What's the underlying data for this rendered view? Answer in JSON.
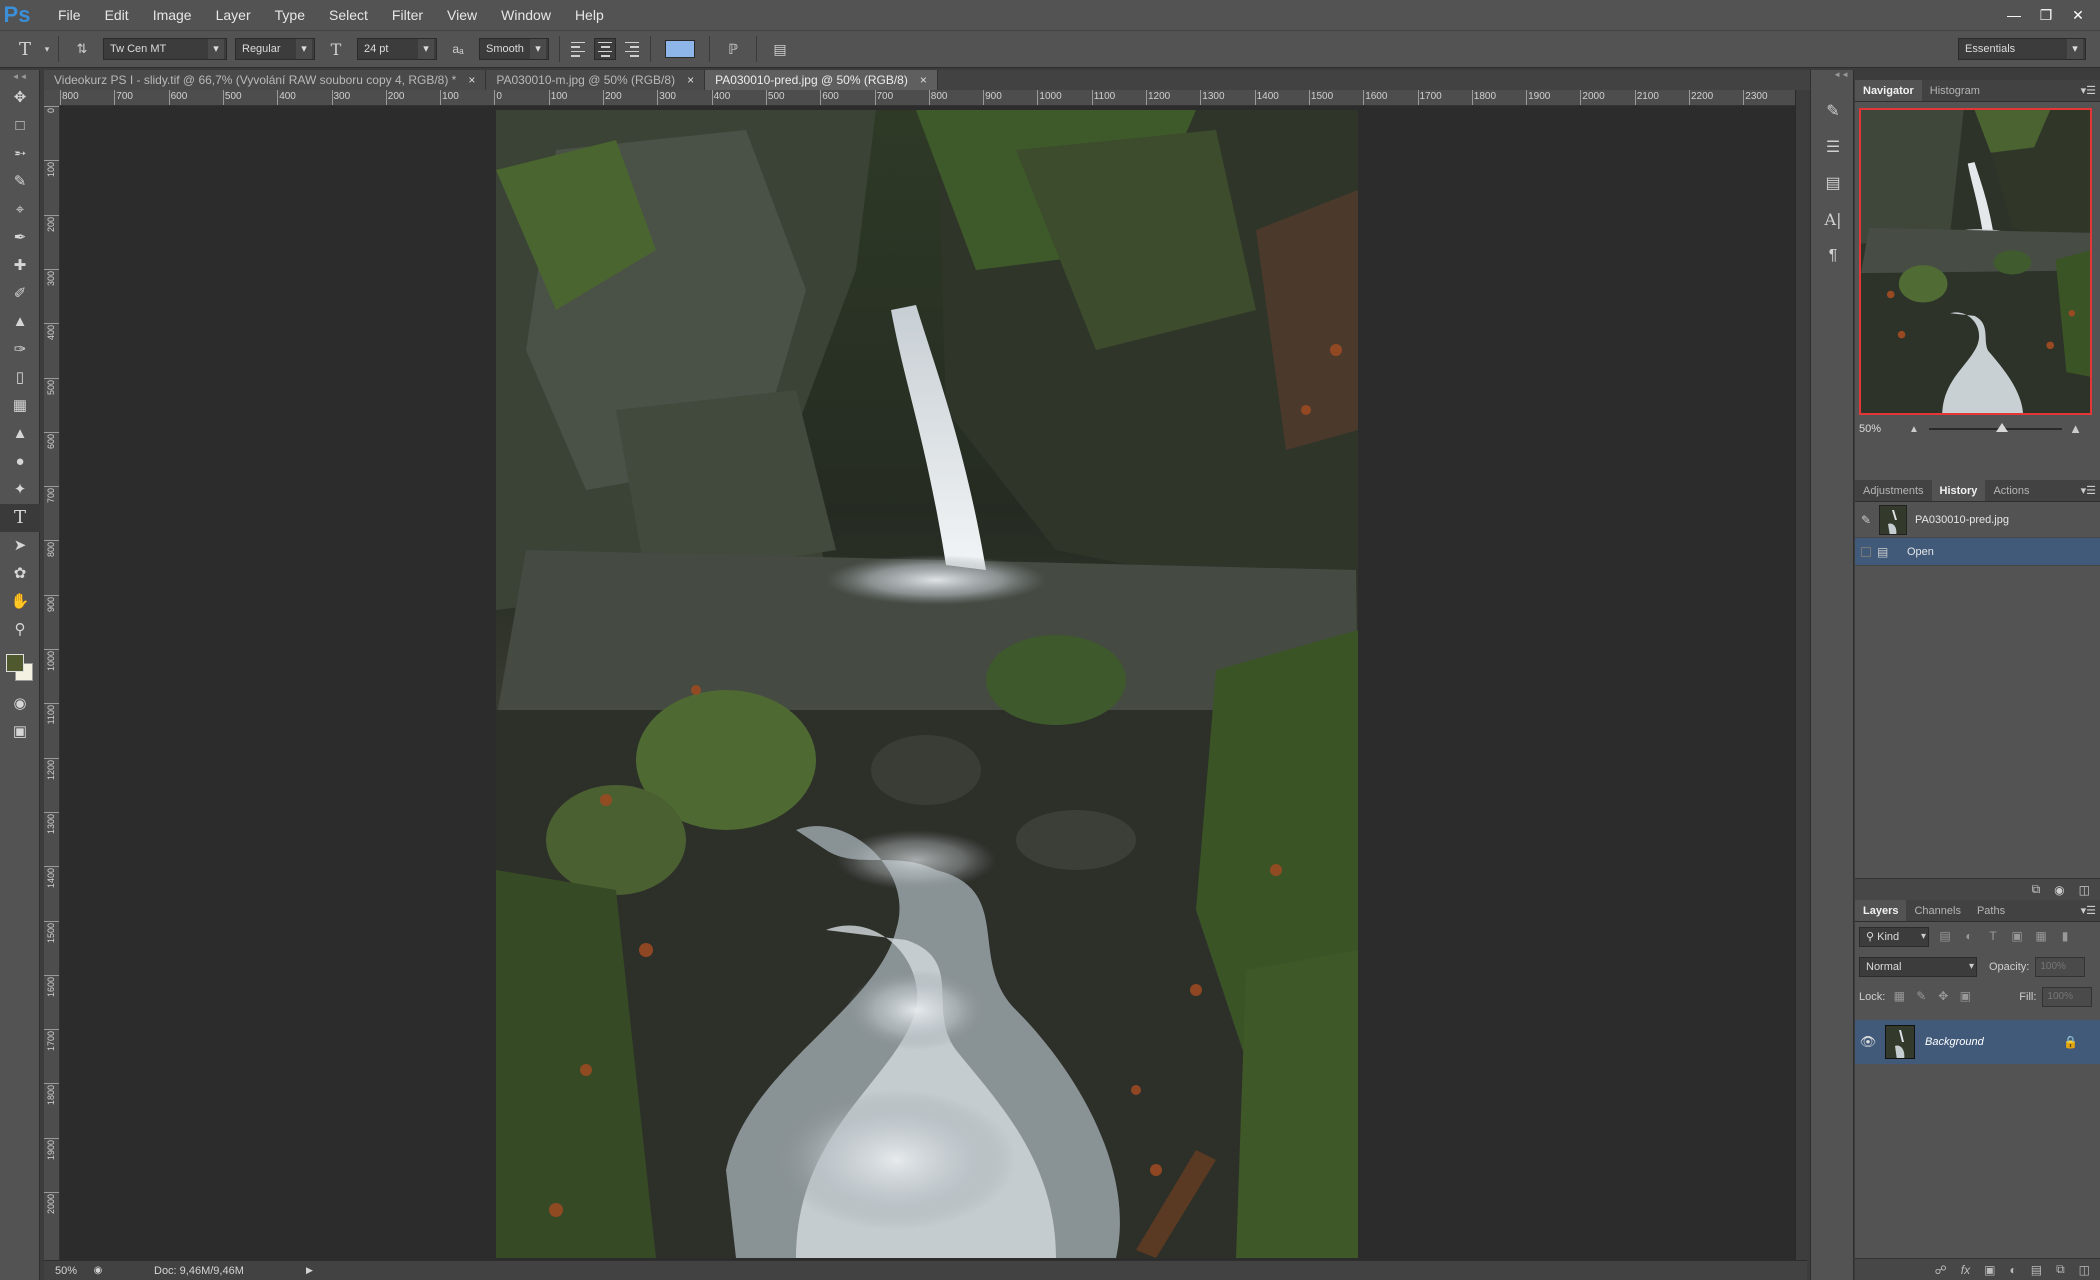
{
  "app": {
    "logo": "Ps"
  },
  "menu": [
    "File",
    "Edit",
    "Image",
    "Layer",
    "Type",
    "Select",
    "Filter",
    "View",
    "Window",
    "Help"
  ],
  "window_controls": {
    "minimize": "—",
    "restore": "❐",
    "close": "✕"
  },
  "options": {
    "font_family": "Tw Cen MT",
    "font_style": "Regular",
    "font_size": "24 pt",
    "antialias": "Smooth",
    "text_color": "#8fb6e8",
    "workspace": "Essentials"
  },
  "tabs": [
    {
      "label": "Videokurz PS I - slidy.tif @ 66,7% (Vyvolání RAW souboru copy 4, RGB/8) *",
      "close": "×"
    },
    {
      "label": "PA030010-m.jpg @ 50% (RGB/8)",
      "close": "×"
    },
    {
      "label": "PA030010-pred.jpg @ 50% (RGB/8)",
      "close": "×"
    }
  ],
  "ruler": {
    "top": [
      "800",
      "700",
      "600",
      "500",
      "400",
      "300",
      "200",
      "100",
      "0",
      "100",
      "200",
      "300",
      "400",
      "500",
      "600",
      "700",
      "800",
      "900",
      "1000",
      "1100",
      "1200",
      "1300",
      "1400",
      "1500",
      "1600",
      "1700",
      "1800",
      "1900",
      "2000",
      "2100",
      "2200",
      "2300"
    ],
    "left": [
      "0",
      "100",
      "200",
      "300",
      "400",
      "500",
      "600",
      "700",
      "800",
      "900",
      "1000",
      "1100",
      "1200",
      "1300",
      "1400",
      "1500",
      "1600",
      "1700",
      "1800",
      "1900",
      "2000"
    ]
  },
  "status": {
    "zoom": "50%",
    "doc": "Doc: 9,46M/9,46M"
  },
  "navigator": {
    "tabs": [
      "Navigator",
      "Histogram"
    ],
    "zoom": "50%",
    "zoom_fraction": 0.55
  },
  "history": {
    "tabs": [
      "Adjustments",
      "History",
      "Actions"
    ],
    "snapshot": "PA030010-pred.jpg",
    "items": [
      "Open"
    ]
  },
  "layers": {
    "tabs": [
      "Layers",
      "Channels",
      "Paths"
    ],
    "filter": "Kind",
    "blend": "Normal",
    "opacity_label": "Opacity:",
    "opacity": "100%",
    "lock_label": "Lock:",
    "fill_label": "Fill:",
    "fill": "100%",
    "items": [
      {
        "name": "Background"
      }
    ]
  },
  "colors": {
    "foreground": "#4e5a2e",
    "background": "#f4f0e2",
    "accent": "#415a7a",
    "navigator_frame": "#e43636"
  }
}
